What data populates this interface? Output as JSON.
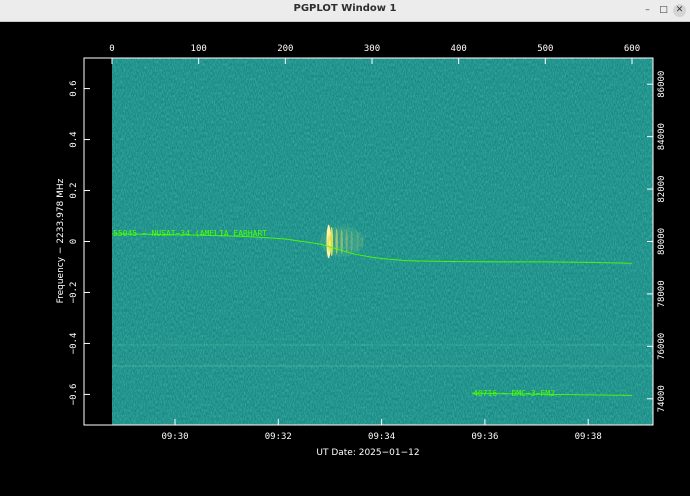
{
  "window": {
    "title": "PGPLOT Window 1",
    "minimize_glyph": "–",
    "maximize_glyph": "□",
    "close_glyph": "✕"
  },
  "plot": {
    "top_axis_ticks": [
      "0",
      "100",
      "200",
      "300",
      "400",
      "500",
      "600"
    ],
    "left_axis_ticks": [
      "0.6",
      "0.4",
      "0.2",
      "0",
      "−0.2",
      "−0.4",
      "−0.6"
    ],
    "right_axis_ticks": [
      "86000",
      "84000",
      "82000",
      "80000",
      "78000",
      "76000",
      "74000"
    ],
    "bottom_axis_ticks": [
      "09:30",
      "09:32",
      "09:34",
      "09:36",
      "09:38"
    ],
    "ylabel": "Frequency − 2233.978 MHz",
    "xlabel": "UT Date: 2025−01−12",
    "colors": {
      "background": "#1a8c85",
      "trace": "#4dff00",
      "axes": "#ffffff"
    }
  },
  "chart_data": {
    "type": "heatmap",
    "xlabel": "UT Date: 2025−01−12",
    "ylabel": "Frequency − 2233.978 MHz",
    "top_axis_range": [
      0,
      600
    ],
    "left_axis_range": [
      -0.72,
      0.72
    ],
    "right_axis_range": [
      73000,
      87000
    ],
    "bottom_axis_ticks": [
      "09:30",
      "09:32",
      "09:34",
      "09:36",
      "09:38"
    ],
    "annotations": [
      "55045 − NUSAT−34 (AMELIA EARHART",
      "40716 − DMC−3−FM2"
    ],
    "traces": [
      {
        "label": "55045 − NUSAT−34 (AMELIA EARHART",
        "x": [
          0,
          50,
          100,
          150,
          180,
          200,
          220,
          240,
          260,
          280,
          300,
          320,
          340,
          360,
          380,
          400,
          450,
          500,
          550,
          600
        ],
        "y": [
          0.03,
          0.028,
          0.025,
          0.02,
          0.015,
          0.01,
          0.0,
          -0.01,
          -0.03,
          -0.05,
          -0.062,
          -0.07,
          -0.075,
          -0.077,
          -0.078,
          -0.079,
          -0.08,
          -0.08,
          -0.082,
          -0.085
        ]
      },
      {
        "label": "40716 − DMC−3−FM2",
        "x": [
          415,
          450,
          500,
          550,
          600
        ],
        "y": [
          -0.595,
          -0.597,
          -0.6,
          -0.602,
          -0.604
        ]
      }
    ],
    "bright_signal": {
      "x_range": [
        240,
        290
      ],
      "y_range": [
        -0.06,
        0.06
      ]
    }
  }
}
